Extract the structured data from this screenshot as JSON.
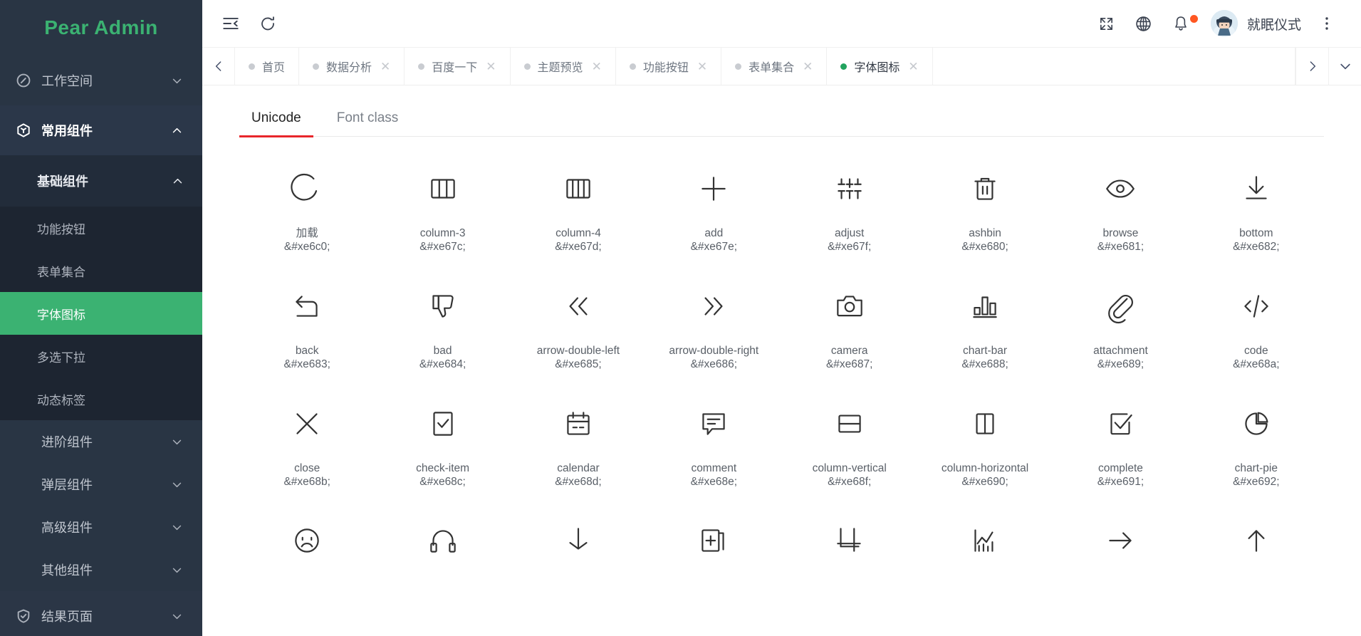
{
  "brand": {
    "title": "Pear Admin",
    "color": "#3bb272"
  },
  "sidebar": {
    "items": [
      {
        "label": "工作空间",
        "icon": "dashboard-icon",
        "state": "collapsed"
      },
      {
        "label": "常用组件",
        "icon": "cube-icon",
        "state": "expanded"
      }
    ],
    "subgroup": {
      "label": "基础组件",
      "state": "expanded"
    },
    "leaves": [
      {
        "label": "功能按钮",
        "active": false
      },
      {
        "label": "表单集合",
        "active": false
      },
      {
        "label": "字体图标",
        "active": true
      },
      {
        "label": "多选下拉",
        "active": false
      },
      {
        "label": "动态标签",
        "active": false
      }
    ],
    "groups": [
      {
        "label": "进阶组件"
      },
      {
        "label": "弹层组件"
      },
      {
        "label": "高级组件"
      },
      {
        "label": "其他组件"
      }
    ],
    "bottom": [
      {
        "label": "结果页面",
        "icon": "shield-check-icon"
      }
    ]
  },
  "topbar": {
    "menu_toggle": "menu-fold-icon",
    "refresh": "refresh-icon",
    "fullscreen": "fullscreen-icon",
    "language": "globe-icon",
    "notification": "bell-icon",
    "notification_badge_color": "#ff5722",
    "username": "就眠仪式",
    "more": "more-vertical-icon"
  },
  "tabbar": {
    "prev": "chevron-left-icon",
    "next": "chevron-right-icon",
    "dropdown": "chevron-down-icon",
    "tabs": [
      {
        "label": "首页",
        "closable": false,
        "active": false
      },
      {
        "label": "数据分析",
        "closable": true,
        "active": false
      },
      {
        "label": "百度一下",
        "closable": true,
        "active": false
      },
      {
        "label": "主题预览",
        "closable": true,
        "active": false
      },
      {
        "label": "功能按钮",
        "closable": true,
        "active": false
      },
      {
        "label": "表单集合",
        "closable": true,
        "active": false
      },
      {
        "label": "字体图标",
        "closable": true,
        "active": true
      }
    ],
    "close_glyph": "✕",
    "active_dot_color": "#22a35e"
  },
  "content": {
    "seg_tabs": [
      {
        "label": "Unicode",
        "active": true
      },
      {
        "label": "Font class",
        "active": false
      }
    ],
    "active_underline_color": "#e8262b",
    "icons": [
      {
        "name": "加载",
        "code": "&#xe6c0;",
        "glyph": "loading-icon"
      },
      {
        "name": "column-3",
        "code": "&#xe67c;",
        "glyph": "column-3-icon"
      },
      {
        "name": "column-4",
        "code": "&#xe67d;",
        "glyph": "column-4-icon"
      },
      {
        "name": "add",
        "code": "&#xe67e;",
        "glyph": "add-icon"
      },
      {
        "name": "adjust",
        "code": "&#xe67f;",
        "glyph": "adjust-icon"
      },
      {
        "name": "ashbin",
        "code": "&#xe680;",
        "glyph": "trash-icon"
      },
      {
        "name": "browse",
        "code": "&#xe681;",
        "glyph": "eye-icon"
      },
      {
        "name": "bottom",
        "code": "&#xe682;",
        "glyph": "arrow-down-line-icon"
      },
      {
        "name": "back",
        "code": "&#xe683;",
        "glyph": "back-icon"
      },
      {
        "name": "bad",
        "code": "&#xe684;",
        "glyph": "thumb-down-icon"
      },
      {
        "name": "arrow-double-left",
        "code": "&#xe685;",
        "glyph": "double-chevron-left-icon"
      },
      {
        "name": "arrow-double-right",
        "code": "&#xe686;",
        "glyph": "double-chevron-right-icon"
      },
      {
        "name": "camera",
        "code": "&#xe687;",
        "glyph": "camera-icon"
      },
      {
        "name": "chart-bar",
        "code": "&#xe688;",
        "glyph": "chart-bar-icon"
      },
      {
        "name": "attachment",
        "code": "&#xe689;",
        "glyph": "paperclip-icon"
      },
      {
        "name": "code",
        "code": "&#xe68a;",
        "glyph": "code-icon"
      },
      {
        "name": "close",
        "code": "&#xe68b;",
        "glyph": "close-x-icon"
      },
      {
        "name": "check-item",
        "code": "&#xe68c;",
        "glyph": "check-box-icon"
      },
      {
        "name": "calendar",
        "code": "&#xe68d;",
        "glyph": "calendar-icon"
      },
      {
        "name": "comment",
        "code": "&#xe68e;",
        "glyph": "comment-icon"
      },
      {
        "name": "column-vertical",
        "code": "&#xe68f;",
        "glyph": "column-vertical-icon"
      },
      {
        "name": "column-horizontal",
        "code": "&#xe690;",
        "glyph": "column-horizontal-icon"
      },
      {
        "name": "complete",
        "code": "&#xe691;",
        "glyph": "complete-check-icon"
      },
      {
        "name": "chart-pie",
        "code": "&#xe692;",
        "glyph": "chart-pie-icon"
      }
    ],
    "partial_row_icons": [
      {
        "glyph": "sad-face-icon"
      },
      {
        "glyph": "headset-icon"
      },
      {
        "glyph": "download-icon"
      },
      {
        "glyph": "add-file-icon"
      },
      {
        "glyph": "crop-icon"
      },
      {
        "glyph": "chart-line-icon"
      },
      {
        "glyph": "arrow-right-icon"
      },
      {
        "glyph": "arrow-up-icon"
      }
    ]
  }
}
